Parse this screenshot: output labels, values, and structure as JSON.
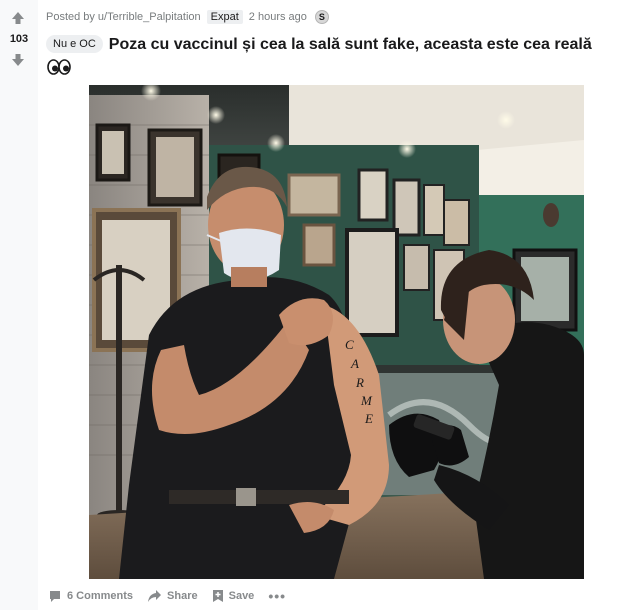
{
  "post": {
    "score": "103",
    "meta": {
      "posted_by_prefix": "Posted by",
      "username": "u/Terrible_Palpitation",
      "user_flair": "Expat",
      "time": "2 hours ago",
      "award_glyph": "S"
    },
    "flair": "Nu e OC",
    "title": "Poza cu vaccinul și cea la sală sunt fake, aceasta este cea reală",
    "emoji_icon": "eyes-emoji-icon",
    "image_ink": "CARME"
  },
  "actions": {
    "comments": "6 Comments",
    "share": "Share",
    "save": "Save",
    "more": "•••"
  },
  "colors": {
    "sidebar_bg": "#f8f9fa",
    "text_primary": "#1a1a1b",
    "text_muted": "#787c7e",
    "action_gray": "#878a8c",
    "flair_bg": "#edeff1"
  }
}
